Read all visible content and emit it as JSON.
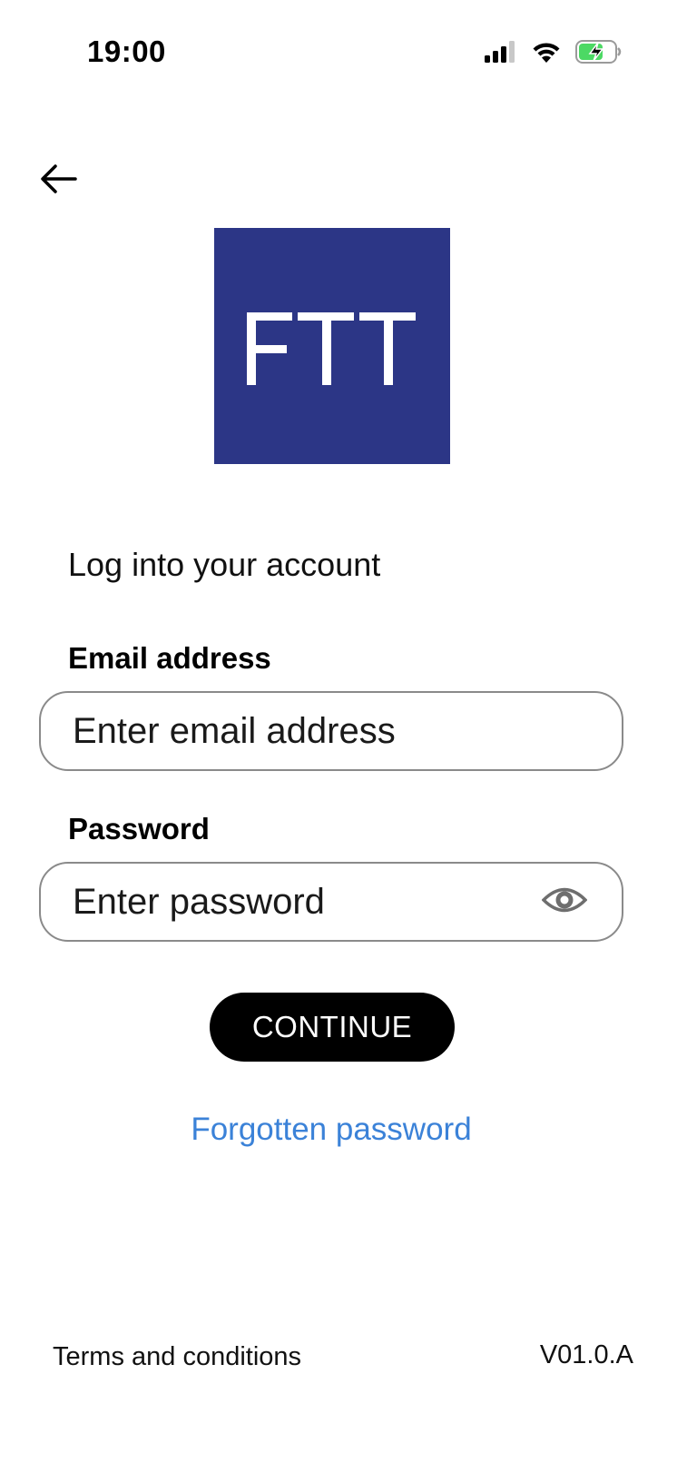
{
  "status_bar": {
    "time": "19:00",
    "icons": [
      "signal-icon",
      "wifi-icon",
      "battery-charging-icon"
    ]
  },
  "header": {
    "back_icon": "arrow-left-icon"
  },
  "logo": {
    "text": "FTT",
    "background_color": "#2c3686"
  },
  "login": {
    "title": "Log into your account",
    "email": {
      "label": "Email address",
      "placeholder": "Enter email address",
      "value": ""
    },
    "password": {
      "label": "Password",
      "placeholder": "Enter password",
      "value": "",
      "toggle_icon": "eye-icon"
    },
    "continue_label": "CONTINUE",
    "forgot_label": "Forgotten password"
  },
  "footer": {
    "terms_label": "Terms and conditions",
    "version": "V01.0.A"
  },
  "colors": {
    "accent_link": "#3b82d8",
    "button_bg": "#000000",
    "brand": "#2c3686"
  }
}
